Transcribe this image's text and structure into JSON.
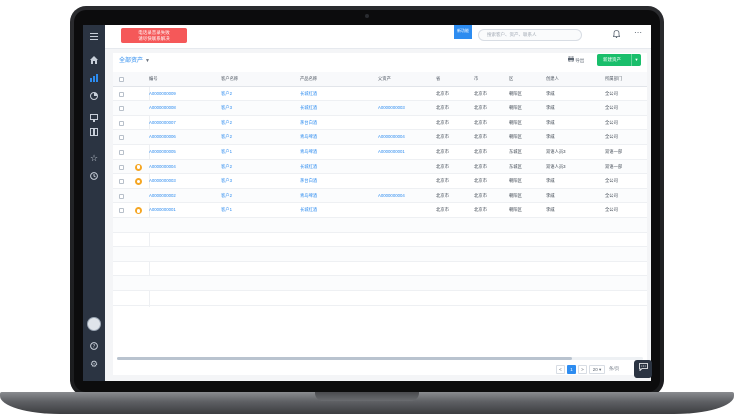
{
  "topbar": {
    "alert_line1": "电话录音录失败",
    "alert_line2": "请尽快联系解决",
    "new_badge": "新功能",
    "search_placeholder": "搜索客户、资产、联系人"
  },
  "toolbar": {
    "view_label": "全部资产",
    "export_label": "导出",
    "create_label": "新建资产"
  },
  "table": {
    "columns": [
      "编号",
      "客户名称",
      "产品名称",
      "父资产",
      "省",
      "市",
      "区",
      "创建人",
      "所属部门"
    ],
    "rows": [
      {
        "id": "A0000000009",
        "customer": "客户2",
        "product": "长城红酒",
        "parent": "",
        "province": "北京市",
        "city": "北京市",
        "district": "朝阳区",
        "creator": "李威",
        "dept": "全公司",
        "mark": false
      },
      {
        "id": "A0000000008",
        "customer": "客户3",
        "product": "长城红酒",
        "parent": "A0000000003",
        "province": "北京市",
        "city": "北京市",
        "district": "朝阳区",
        "creator": "李威",
        "dept": "全公司",
        "mark": false
      },
      {
        "id": "A0000000007",
        "customer": "客户2",
        "product": "茅台白酒",
        "parent": "",
        "province": "北京市",
        "city": "北京市",
        "district": "朝阳区",
        "creator": "李威",
        "dept": "全公司",
        "mark": false
      },
      {
        "id": "A0000000006",
        "customer": "客户2",
        "product": "青岛啤酒",
        "parent": "A0000000004",
        "province": "北京市",
        "city": "北京市",
        "district": "朝阳区",
        "creator": "李威",
        "dept": "全公司",
        "mark": false
      },
      {
        "id": "A0000000005",
        "customer": "客户1",
        "product": "青岛啤酒",
        "parent": "A0000000001",
        "province": "北京市",
        "city": "北京市",
        "district": "东城区",
        "creator": "双语人员3",
        "dept": "双语一部",
        "mark": false
      },
      {
        "id": "A0000000004",
        "customer": "客户2",
        "product": "长城红酒",
        "parent": "",
        "province": "北京市",
        "city": "北京市",
        "district": "东城区",
        "creator": "双语人员3",
        "dept": "双语一部",
        "mark": true
      },
      {
        "id": "A0000000003",
        "customer": "客户3",
        "product": "茅台白酒",
        "parent": "",
        "province": "北京市",
        "city": "北京市",
        "district": "朝阳区",
        "creator": "李威",
        "dept": "全公司",
        "mark": true
      },
      {
        "id": "A0000000002",
        "customer": "客户2",
        "product": "青岛啤酒",
        "parent": "A0000000004",
        "province": "北京市",
        "city": "北京市",
        "district": "朝阳区",
        "creator": "李威",
        "dept": "全公司",
        "mark": false
      },
      {
        "id": "A0000000001",
        "customer": "客户1",
        "product": "长城红酒",
        "parent": "",
        "province": "北京市",
        "city": "北京市",
        "district": "朝阳区",
        "creator": "李威",
        "dept": "全公司",
        "mark": true
      }
    ],
    "empty_rows": 6
  },
  "pagination": {
    "prev": "<",
    "current": "1",
    "next": ">",
    "page_size": "20",
    "page_size_label": "条/页"
  },
  "icons": {
    "menu": "menu-icon",
    "home": "home-icon",
    "chart": "bar-chart-icon",
    "pie": "pie-chart-icon",
    "monitor": "monitor-icon",
    "book": "book-icon",
    "star": "star-icon",
    "history": "clock-icon",
    "help": "help-icon",
    "settings": "gear-icon",
    "bell": "bell-icon",
    "more": "more-icon",
    "chat": "chat-icon"
  },
  "colors": {
    "sidebar": "#2b3442",
    "accent": "#2d8cf0",
    "create": "#19be6b",
    "alert": "#f55859",
    "mark": "#f5a623"
  }
}
